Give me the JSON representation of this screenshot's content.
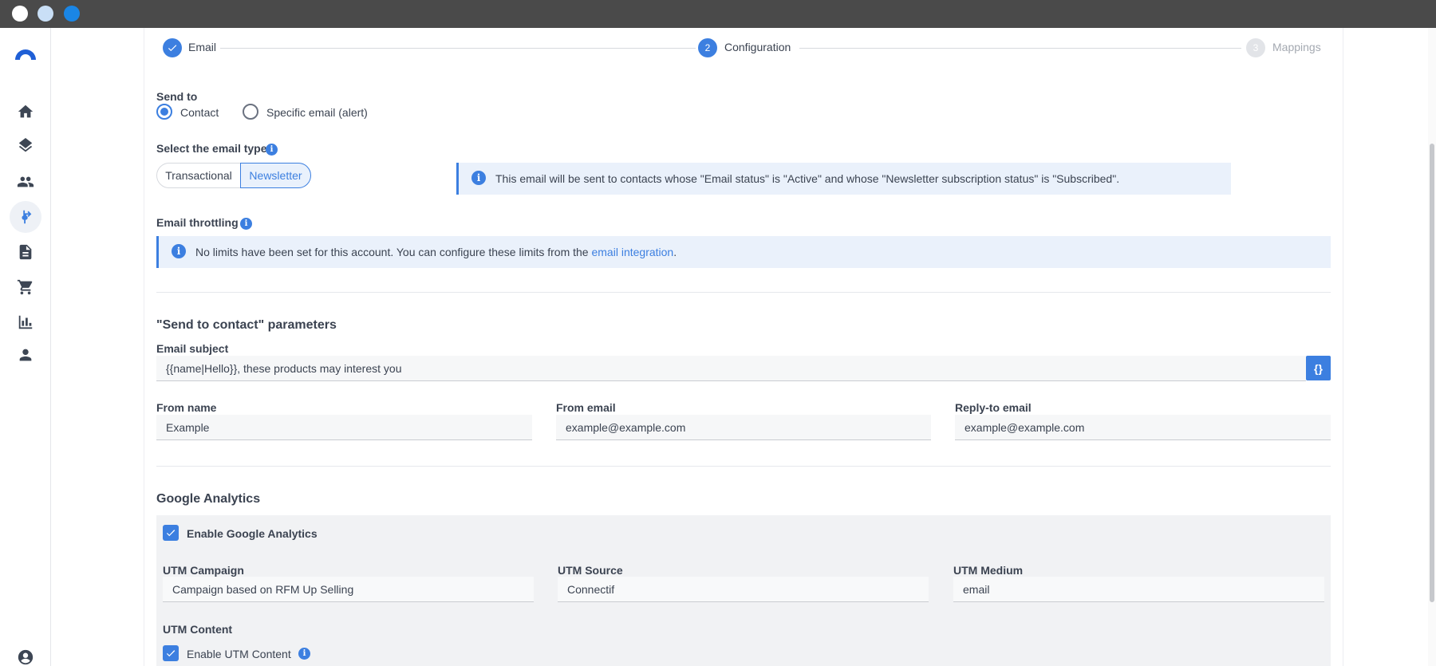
{
  "stepper": {
    "steps": [
      {
        "number": "",
        "label": "Email",
        "state": "done"
      },
      {
        "number": "2",
        "label": "Configuration",
        "state": "active"
      },
      {
        "number": "3",
        "label": "Mappings",
        "state": "pending"
      }
    ]
  },
  "send_to": {
    "label": "Send to",
    "options": [
      {
        "label": "Contact",
        "selected": true
      },
      {
        "label": "Specific email (alert)",
        "selected": false
      }
    ]
  },
  "email_type": {
    "label": "Select the email type",
    "options": [
      "Transactional",
      "Newsletter"
    ],
    "selected": "Newsletter",
    "info_text": "This email will be sent to contacts whose \"Email status\" is \"Active\" and whose \"Newsletter subscription status\" is \"Subscribed\"."
  },
  "throttling": {
    "label": "Email throttling",
    "message_prefix": "No limits have been set for this account. You can configure these limits from the ",
    "link_text": "email integration",
    "message_suffix": "."
  },
  "params": {
    "title": "\"Send to contact\" parameters",
    "subject_label": "Email subject",
    "subject_value": "{{name|Hello}}, these products may interest you",
    "variables_button": "{}",
    "from_name_label": "From name",
    "from_name_value": "Example",
    "from_email_label": "From email",
    "from_email_value": "example@example.com",
    "reply_to_label": "Reply-to email",
    "reply_to_value": "example@example.com"
  },
  "analytics": {
    "title": "Google Analytics",
    "enable_label": "Enable Google Analytics",
    "enabled": true,
    "campaign_label": "UTM Campaign",
    "campaign_value": "Campaign based on RFM Up Selling",
    "source_label": "UTM Source",
    "source_value": "Connectif",
    "medium_label": "UTM Medium",
    "medium_value": "email",
    "content_label": "UTM Content",
    "content_enable_label": "Enable UTM Content",
    "content_enabled": true
  },
  "colors": {
    "accent": "#3c7fe0",
    "titlebar": "#4a4a4a",
    "info_bg": "#eaf1fb"
  },
  "sidebar": {
    "items": [
      "home-icon",
      "layers-icon",
      "contacts-icon",
      "workflows-icon",
      "document-icon",
      "cart-icon",
      "chart-icon",
      "user-icon",
      "account-icon"
    ],
    "active": "workflows-icon"
  }
}
